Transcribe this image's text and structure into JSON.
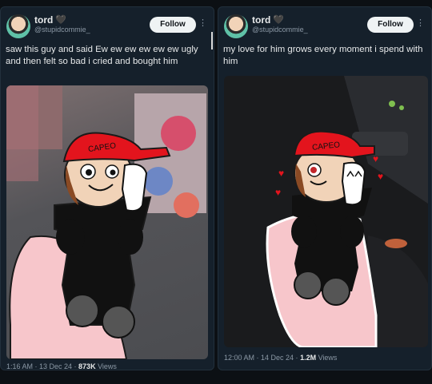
{
  "tweets": [
    {
      "name": "tord",
      "handle": "@stupidcommie_",
      "follow_label": "Follow",
      "text": "saw this guy and said Ew ew ew ew ew ew ugly and then felt so bad i cried and bought him",
      "time": "1:16 AM · 13 Dec 24 · ",
      "views_count": "873K",
      "views_label": " Views",
      "plush_hat_text": "CAPEO"
    },
    {
      "name": "tord",
      "handle": "@stupidcommie_",
      "follow_label": "Follow",
      "text": "my love for him grows every moment i spend with him",
      "time": "12:00 AM · 14 Dec 24 · ",
      "views_count": "1.2M",
      "views_label": " Views",
      "plush_hat_text": "CAPEO"
    }
  ],
  "icons": {
    "heart": "black-heart-icon",
    "more": "more-icon"
  },
  "colors": {
    "bg": "#15202b",
    "text": "#e7e9ea",
    "muted": "#8b98a5",
    "hat": "#e3141d",
    "hand": "#f7c6cb"
  }
}
